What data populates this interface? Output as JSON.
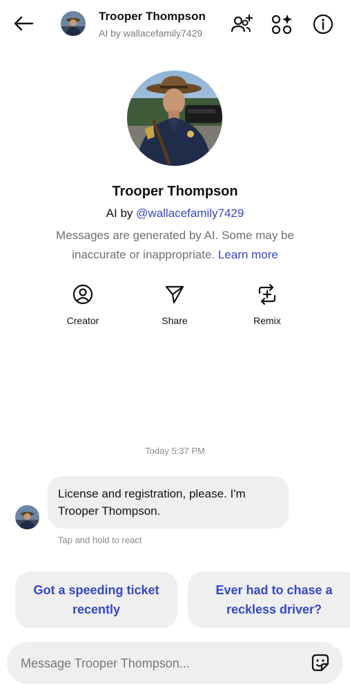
{
  "header": {
    "back_icon": "arrow-left-icon",
    "name": "Trooper Thompson",
    "subtitle": "AI by wallacefamily7429",
    "add_people_icon": "add-people-icon",
    "apps_icon": "apps-sparkle-icon",
    "info_icon": "info-icon"
  },
  "profile": {
    "name": "Trooper Thompson",
    "by_prefix": "AI by",
    "creator_handle": "@wallacefamily7429",
    "disclaimer": "Messages are generated by AI. Some may be inaccurate or inappropriate.",
    "learn_more": "Learn more"
  },
  "actions": [
    {
      "label": "Creator",
      "icon": "user-circle-icon"
    },
    {
      "label": "Share",
      "icon": "send-icon"
    },
    {
      "label": "Remix",
      "icon": "remix-icon"
    }
  ],
  "chat": {
    "timestamp": "Today 5:37 PM",
    "message": "License and registration, please. I'm Trooper Thompson.",
    "react_hint": "Tap and hold to react"
  },
  "suggestions": [
    "Got a speeding ticket recently",
    "Ever had to chase a reckless driver?"
  ],
  "composer": {
    "placeholder": "Message Trooper Thompson...",
    "sticker_icon": "sticker-icon"
  },
  "colors": {
    "accent": "#3348c4",
    "bubble": "#efefef"
  }
}
